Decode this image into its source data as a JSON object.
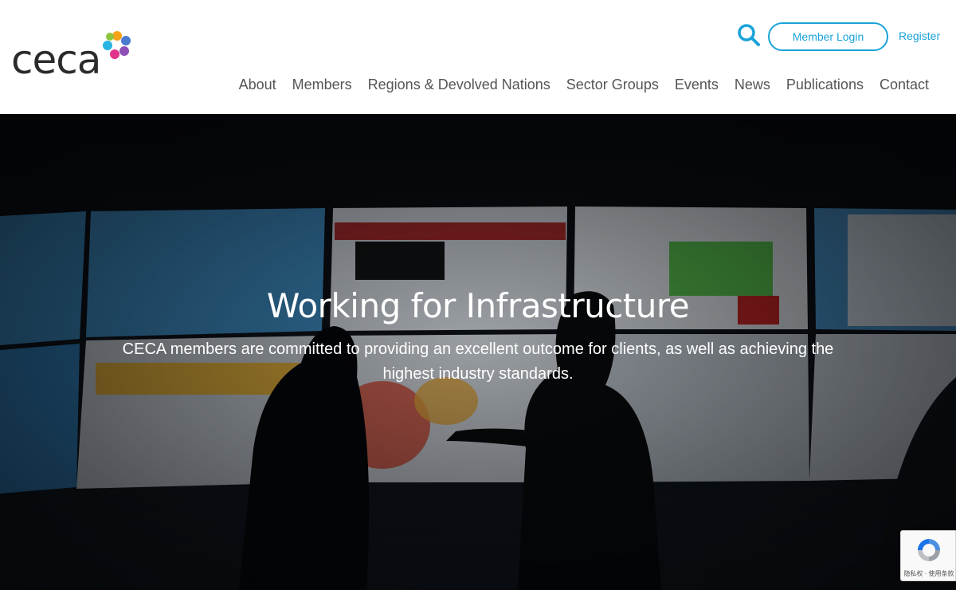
{
  "logo": {
    "text": "ceca"
  },
  "header": {
    "search_icon": "search-icon",
    "login_label": "Member Login",
    "register_label": "Register",
    "accent_color": "#1aa3d9"
  },
  "nav": {
    "items": [
      "About",
      "Members",
      "Regions & Devolved Nations",
      "Sector Groups",
      "Events",
      "News",
      "Publications",
      "Contact"
    ]
  },
  "hero": {
    "title": "Working for Infrastructure",
    "subtitle": "CECA members are committed to providing an excellent outcome for clients, as well as achieving the highest industry standards."
  },
  "recaptcha": {
    "footer_text": "隐私权 · 使用条款"
  }
}
